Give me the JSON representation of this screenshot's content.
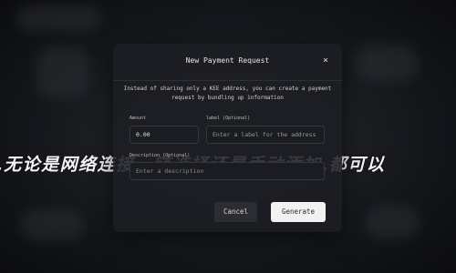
{
  "background": {
    "overlay_text": ",无论是网络连接、链选择还是手动添加,都可以"
  },
  "modal": {
    "title": "New Payment Request",
    "close_glyph": "×",
    "description": "Instead of sharing only a KEE address, you can create a payment request by bundling up information",
    "amount": {
      "label": "Amount",
      "value": "0.00"
    },
    "label_field": {
      "label": "label (Optional)",
      "placeholder": "Enter a label for the address"
    },
    "description_field": {
      "label": "Description (Optional)",
      "placeholder": "Enter a description"
    },
    "buttons": {
      "cancel": "Cancel",
      "generate": "Generate"
    }
  },
  "colors": {
    "modal_bg": "#1c1e23",
    "primary_button": "#f2f2f2",
    "secondary_button": "#2b2d32"
  }
}
